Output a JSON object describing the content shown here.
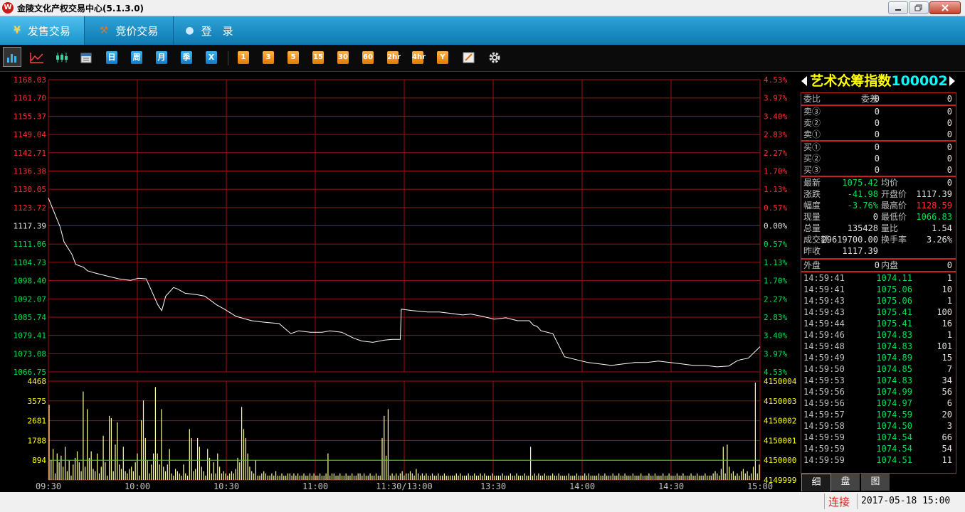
{
  "window": {
    "title": "金陵文化产权交易中心(5.1.3.0)",
    "logo_text": "W"
  },
  "nav": {
    "tabs": [
      {
        "label": "发售交易",
        "icon": "yen-icon",
        "active": true
      },
      {
        "label": "竞价交易",
        "icon": "gavel-icon",
        "active": false
      },
      {
        "label": "登　录",
        "icon": "user-icon",
        "active": false
      }
    ]
  },
  "toolbar": {
    "chart_buttons": [
      "intraday-chart-icon",
      "line-chart-icon",
      "candlestick-icon",
      "calendar-icon"
    ],
    "period_buttons": [
      "日",
      "周",
      "月",
      "季",
      "X"
    ],
    "minute_buttons": [
      "1",
      "3",
      "5",
      "15",
      "30",
      "60",
      "2hr",
      "4hr",
      "Y"
    ],
    "tool_buttons": [
      "draw-icon",
      "settings-icon"
    ]
  },
  "colors": {
    "grid": "#a01010",
    "price_line": "#ffffff",
    "volume_bar": "#ffff99",
    "volume_line": "#00ff00",
    "up": "#ff3030",
    "down": "#00e050"
  },
  "chart_data": {
    "type": "line",
    "title": "",
    "xlabel": "",
    "ylabel": "",
    "x_ticks": [
      "09:30",
      "10:00",
      "10:30",
      "11:00",
      "11:30/13:00",
      "13:30",
      "14:00",
      "14:30",
      "15:00"
    ],
    "y_ticks_left": [
      "1168.03",
      "1161.70",
      "1155.37",
      "1149.04",
      "1142.71",
      "1136.38",
      "1130.05",
      "1123.72",
      "1117.39",
      "1111.06",
      "1104.73",
      "1098.40",
      "1092.07",
      "1085.74",
      "1079.41",
      "1073.08",
      "1066.75"
    ],
    "y_ticks_right": [
      "4.53%",
      "3.97%",
      "3.40%",
      "2.83%",
      "2.27%",
      "1.70%",
      "1.13%",
      "0.57%",
      "0.00%",
      "0.57%",
      "1.13%",
      "1.70%",
      "2.27%",
      "2.83%",
      "3.40%",
      "3.97%",
      "4.53%"
    ],
    "ylim": [
      1066.75,
      1168.03
    ],
    "prev_close": 1117.39,
    "x_minutes": [
      0,
      6,
      8,
      12,
      14,
      18,
      20,
      24,
      30,
      36,
      42,
      46,
      50,
      56,
      58,
      60,
      64,
      66,
      70,
      76,
      80,
      82,
      86,
      90,
      96,
      104,
      110,
      118,
      124,
      128,
      134,
      140,
      144,
      150,
      156,
      160,
      166,
      172,
      176,
      180,
      180.5,
      186,
      194,
      200,
      206,
      212,
      216,
      222,
      228,
      234,
      240,
      246,
      248,
      250,
      252,
      258,
      264,
      270,
      276,
      282,
      288,
      294,
      300,
      306,
      312,
      318,
      324,
      330,
      336,
      342,
      348,
      352,
      354,
      358,
      364
    ],
    "price": [
      1127.0,
      1117.0,
      1111.8,
      1107.5,
      1104.0,
      1103.0,
      1101.8,
      1101.0,
      1100.0,
      1099.0,
      1098.5,
      1099.2,
      1099.0,
      1090.0,
      1088.0,
      1093.0,
      1096.0,
      1095.5,
      1094.0,
      1093.5,
      1093.0,
      1092.0,
      1090.0,
      1088.5,
      1086.0,
      1084.5,
      1084.0,
      1083.5,
      1080.0,
      1081.0,
      1080.5,
      1080.5,
      1081.0,
      1080.5,
      1078.5,
      1077.5,
      1077.0,
      1077.8,
      1078.0,
      1078.0,
      1088.5,
      1088.0,
      1087.5,
      1087.5,
      1087.0,
      1086.5,
      1086.8,
      1086.0,
      1085.0,
      1085.5,
      1084.5,
      1084.5,
      1083.0,
      1082.5,
      1081.0,
      1080.0,
      1072.0,
      1071.0,
      1070.0,
      1069.5,
      1069.0,
      1069.5,
      1070.0,
      1070.0,
      1070.5,
      1070.0,
      1069.5,
      1069.0,
      1069.0,
      1068.5,
      1068.8,
      1070.5,
      1071.0,
      1071.5,
      1075.5
    ],
    "volume_ylim": [
      0,
      4468
    ],
    "volume_y_ticks_left": [
      "4468",
      "3575",
      "2681",
      "1788",
      "894"
    ],
    "volume_y_ticks_right": [
      "4150004",
      "4150003",
      "4150002",
      "4150001",
      "4150000",
      "4149999"
    ],
    "volume_avg_level": 894,
    "volume": [
      3400,
      900,
      1400,
      300,
      1200,
      800,
      1100,
      600,
      1500,
      400,
      900,
      200,
      700,
      1000,
      1300,
      800,
      400,
      4000,
      600,
      3200,
      1000,
      1300,
      500,
      400,
      1200,
      300,
      600,
      2000,
      800,
      200,
      2900,
      2800,
      400,
      1600,
      2600,
      700,
      500,
      1500,
      400,
      300,
      500,
      600,
      400,
      800,
      1200,
      200,
      2700,
      3600,
      1900,
      900,
      300,
      700,
      1200,
      4200,
      1200,
      700,
      3200,
      600,
      400,
      700,
      1400,
      300,
      200,
      500,
      400,
      300,
      200,
      700,
      300,
      200,
      2300,
      1900,
      400,
      500,
      1900,
      1500,
      600,
      400,
      200,
      1400,
      1000,
      300,
      800,
      300,
      1200,
      600,
      300,
      400,
      300,
      200,
      300,
      400,
      300,
      500,
      1000,
      800,
      3300,
      2300,
      1900,
      1200,
      600,
      400,
      300,
      900,
      200,
      200,
      300,
      400,
      300,
      200,
      200,
      300,
      200,
      400,
      200,
      200,
      300,
      200,
      200,
      300,
      300,
      200,
      300,
      200,
      300,
      200,
      200,
      300,
      200,
      200,
      300,
      200,
      300,
      200,
      200,
      300,
      200,
      200,
      300,
      1200,
      200,
      300,
      300,
      200,
      200,
      300,
      200,
      200,
      300,
      200,
      200,
      300,
      200,
      200,
      300,
      300,
      200,
      300,
      200,
      200,
      300,
      200,
      200,
      300,
      200,
      200,
      1900,
      2900,
      1100,
      3200,
      200,
      300,
      200,
      300,
      200,
      300,
      400,
      200,
      300,
      300,
      400,
      300,
      200,
      500,
      300,
      200,
      300,
      200,
      300,
      200,
      200,
      300,
      200,
      200,
      300,
      200,
      200,
      300,
      200,
      200,
      200,
      200,
      200,
      300,
      200,
      300,
      200,
      200,
      200,
      300,
      200,
      200,
      300,
      200,
      200,
      300,
      200,
      300,
      200,
      200,
      200,
      300,
      200,
      200,
      200,
      200,
      300,
      200,
      200,
      200,
      300,
      200,
      200,
      300,
      200,
      200,
      200,
      300,
      200,
      200,
      1500,
      200,
      300,
      200,
      300,
      200,
      200,
      300,
      200,
      200,
      200,
      300,
      200,
      200,
      300,
      200,
      200,
      200,
      200,
      300,
      200,
      200,
      200,
      300,
      200,
      200,
      200,
      300,
      200,
      300,
      200,
      200,
      200,
      200,
      300,
      200,
      200,
      300,
      200,
      200,
      200,
      300,
      200,
      200,
      300,
      200,
      200,
      300,
      200,
      200,
      200,
      300,
      200,
      200,
      200,
      300,
      200,
      200,
      200,
      300,
      200,
      200,
      300,
      200,
      200,
      200,
      300,
      200,
      200,
      300,
      200,
      200,
      200,
      300,
      200,
      200,
      300,
      200,
      200,
      200,
      300,
      200,
      200,
      300,
      200,
      200,
      200,
      300,
      200,
      200,
      200,
      300,
      400,
      300,
      200,
      500,
      1500,
      300,
      1600,
      600,
      300,
      400,
      200,
      300,
      200,
      400,
      500,
      300,
      400,
      200,
      300,
      600,
      4400,
      300,
      700
    ]
  },
  "right_panel": {
    "title": "艺术众筹指数",
    "code": "100002",
    "weibi": {
      "label": "委比",
      "value": "0",
      "label2": "委差",
      "value2": "0"
    },
    "sell": [
      {
        "label": "卖③",
        "price": "0",
        "vol": "0"
      },
      {
        "label": "卖②",
        "price": "0",
        "vol": "0"
      },
      {
        "label": "卖①",
        "price": "0",
        "vol": "0"
      }
    ],
    "buy": [
      {
        "label": "买①",
        "price": "0",
        "vol": "0"
      },
      {
        "label": "买②",
        "price": "0",
        "vol": "0"
      },
      {
        "label": "买③",
        "price": "0",
        "vol": "0"
      }
    ],
    "quote": [
      {
        "l1": "最新",
        "v1": "1075.42",
        "c1": "green",
        "l2": "均价",
        "v2": "0",
        "c2": "white"
      },
      {
        "l1": "涨跌",
        "v1": "-41.98",
        "c1": "green",
        "l2": "开盘价",
        "v2": "1117.39",
        "c2": "white"
      },
      {
        "l1": "幅度",
        "v1": "-3.76%",
        "c1": "green",
        "l2": "最高价",
        "v2": "1128.59",
        "c2": "red"
      },
      {
        "l1": "现量",
        "v1": "0",
        "c1": "white",
        "l2": "最低价",
        "v2": "1066.83",
        "c2": "green"
      },
      {
        "l1": "总量",
        "v1": "135428",
        "c1": "white",
        "l2": "量比",
        "v2": "1.54",
        "c2": "white"
      },
      {
        "l1": "成交额",
        "v1": "29619700.00",
        "c1": "white",
        "l2": "换手率",
        "v2": "3.26%",
        "c2": "white"
      },
      {
        "l1": "昨收",
        "v1": "1117.39",
        "c1": "white",
        "l2": "",
        "v2": "",
        "c2": "white"
      }
    ],
    "waipan": {
      "label": "外盘",
      "value": "0",
      "label2": "内盘",
      "value2": "0"
    },
    "ticks": [
      {
        "time": "14:59:41",
        "price": "1074.11",
        "vol": "1"
      },
      {
        "time": "14:59:41",
        "price": "1075.06",
        "vol": "10"
      },
      {
        "time": "14:59:43",
        "price": "1075.06",
        "vol": "1"
      },
      {
        "time": "14:59:43",
        "price": "1075.41",
        "vol": "100"
      },
      {
        "time": "14:59:44",
        "price": "1075.41",
        "vol": "16"
      },
      {
        "time": "14:59:46",
        "price": "1074.83",
        "vol": "1"
      },
      {
        "time": "14:59:48",
        "price": "1074.83",
        "vol": "101"
      },
      {
        "time": "14:59:49",
        "price": "1074.89",
        "vol": "15"
      },
      {
        "time": "14:59:50",
        "price": "1074.85",
        "vol": "7"
      },
      {
        "time": "14:59:53",
        "price": "1074.83",
        "vol": "34"
      },
      {
        "time": "14:59:56",
        "price": "1074.99",
        "vol": "56"
      },
      {
        "time": "14:59:56",
        "price": "1074.97",
        "vol": "6"
      },
      {
        "time": "14:59:57",
        "price": "1074.59",
        "vol": "20"
      },
      {
        "time": "14:59:58",
        "price": "1074.50",
        "vol": "3"
      },
      {
        "time": "14:59:59",
        "price": "1074.54",
        "vol": "66"
      },
      {
        "time": "14:59:59",
        "price": "1074.54",
        "vol": "54"
      },
      {
        "time": "14:59:59",
        "price": "1074.51",
        "vol": "11"
      }
    ],
    "bottom_tabs": [
      {
        "label": "细",
        "active": true
      },
      {
        "label": "盘",
        "active": false
      },
      {
        "label": "图",
        "active": false
      }
    ]
  },
  "status": {
    "connection": "连接",
    "datetime": "2017-05-18 15:00"
  }
}
